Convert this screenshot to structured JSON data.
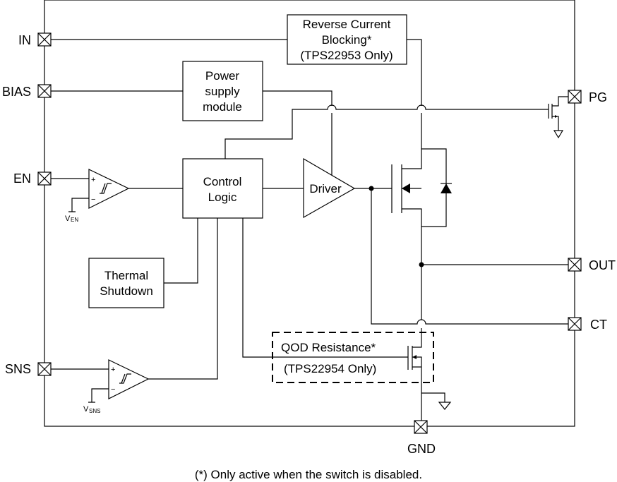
{
  "pins": {
    "in": "IN",
    "bias": "BIAS",
    "en": "EN",
    "sns": "SNS",
    "pg": "PG",
    "out": "OUT",
    "ct": "CT",
    "gnd": "GND"
  },
  "blocks": {
    "reverse_current": [
      "Reverse Current",
      "Blocking*",
      "(TPS22953 Only)"
    ],
    "power_supply": [
      "Power",
      "supply",
      "module"
    ],
    "control_logic": [
      "Control",
      "Logic"
    ],
    "driver": "Driver",
    "thermal_shutdown": [
      "Thermal",
      "Shutdown"
    ],
    "qod": [
      "QOD Resistance*",
      "(TPS22954 Only)"
    ]
  },
  "comparators": {
    "en_ref": {
      "main": "V",
      "sub": "EN"
    },
    "sns_ref": {
      "main": "V",
      "sub": "SNS"
    },
    "plus": "+",
    "minus": "−"
  },
  "footnote": "(*) Only active when the switch is disabled."
}
